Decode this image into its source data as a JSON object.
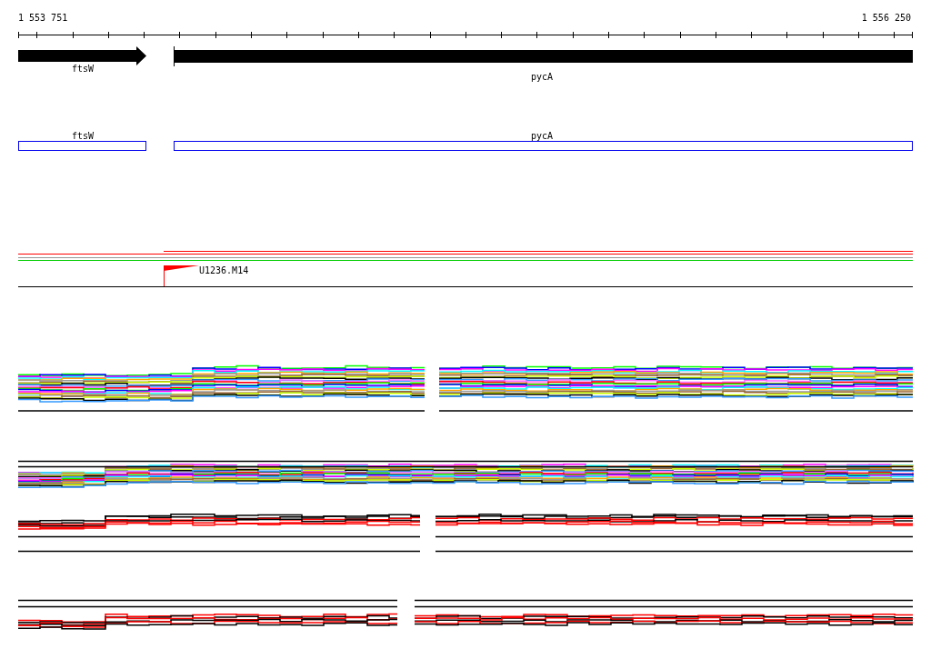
{
  "ruler": {
    "start_label": "1 553 751",
    "end_label": "1 556 250"
  },
  "gene_tracks": [
    {
      "kind": "arrow",
      "genes": [
        {
          "label": "ftsW"
        },
        {
          "label": "pycA"
        }
      ]
    },
    {
      "kind": "box",
      "genes": [
        {
          "label": "ftsW"
        },
        {
          "label": "pycA"
        }
      ]
    }
  ],
  "features": [
    {
      "label": "U1236.M14"
    }
  ]
}
